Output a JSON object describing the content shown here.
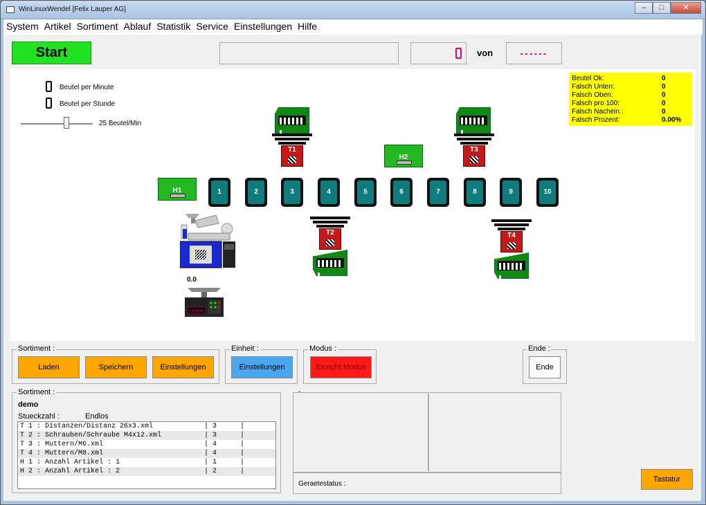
{
  "window": {
    "title": "WinLinuxWendel [Felix Lauper AG]"
  },
  "menu": [
    "System",
    "Artikel",
    "Sortiment",
    "Ablauf",
    "Statistik",
    "Service",
    "Einstellungen",
    "Hilfe"
  ],
  "top": {
    "start_label": "Start",
    "counter_value": "0",
    "von_label": "von",
    "target_value": "------"
  },
  "rates": {
    "per_minute_label": "Beutel per Minute",
    "per_hour_label": "Beutel per Stunde",
    "slider_label": "25 Beutel/Min",
    "slider_value": 25
  },
  "stats": [
    {
      "label": "Beutel Ok:",
      "value": "0"
    },
    {
      "label": "Falsch Unten:",
      "value": "0"
    },
    {
      "label": "Falsch Oben:",
      "value": "0"
    },
    {
      "label": "Falsch pro 100:",
      "value": "0"
    },
    {
      "label": "Falsch Nachein.:",
      "value": "0"
    },
    {
      "label": "Falsch Prozent:",
      "value": "0.00%"
    }
  ],
  "slots": [
    "1",
    "2",
    "3",
    "4",
    "5",
    "6",
    "7",
    "8",
    "9",
    "10"
  ],
  "hoppers": {
    "h1": "H1",
    "h2": "H2"
  },
  "tools": {
    "t1": "T1",
    "t2": "T2",
    "t3": "T3",
    "t4": "T4"
  },
  "scale_value": "0.0",
  "scale_display": "L0400",
  "groups": {
    "sortiment": {
      "title": "Sortiment :",
      "laden": "Laden",
      "speichern": "Speichern",
      "einstellungen": "Einstellungen"
    },
    "einheit": {
      "title": "Einheit :",
      "einstellungen": "Einstellungen"
    },
    "modus": {
      "title": "Modus :",
      "einricht": "Einricht Modus"
    },
    "ende": {
      "title": "Ende :",
      "ende": "Ende"
    }
  },
  "sortiment_info": {
    "title": "Sortiment :",
    "name": "demo",
    "stueckzahl_label": "Stueckzahl :",
    "stueckzahl_value": "Endlos",
    "rows": [
      {
        "c1": "T 1 : Distanzen/Distanz 26x3.xml",
        "c2": "| 3",
        "c3": "|"
      },
      {
        "c1": "T 2 : Schrauben/Schraube M4x12.xml",
        "c2": "| 3",
        "c3": "|"
      },
      {
        "c1": "T 3 : Muttern/M6.xml",
        "c2": "| 4",
        "c3": "|"
      },
      {
        "c1": "T 4 : Muttern/M8.xml",
        "c2": "| 4",
        "c3": "|"
      },
      {
        "c1": "H 1 : Anzahl Artikel : 1",
        "c2": "| 1",
        "c3": "|"
      },
      {
        "c1": "H 2 : Anzahl Artikel : 2",
        "c2": "| 2",
        "c3": "|"
      }
    ]
  },
  "status": {
    "geraetestatus_label": "Geraetestatus :",
    "extra_label": "-"
  },
  "tastatur_label": "Tastatur",
  "colors": {
    "start": "#22e022",
    "orange": "#ffa500",
    "blue": "#4aa8f0",
    "red": "#ff1a1a",
    "stats_bg": "#ffff00",
    "slot": "#0f7d7d",
    "tool": "#c21a1a",
    "hopper": "#22b822"
  }
}
